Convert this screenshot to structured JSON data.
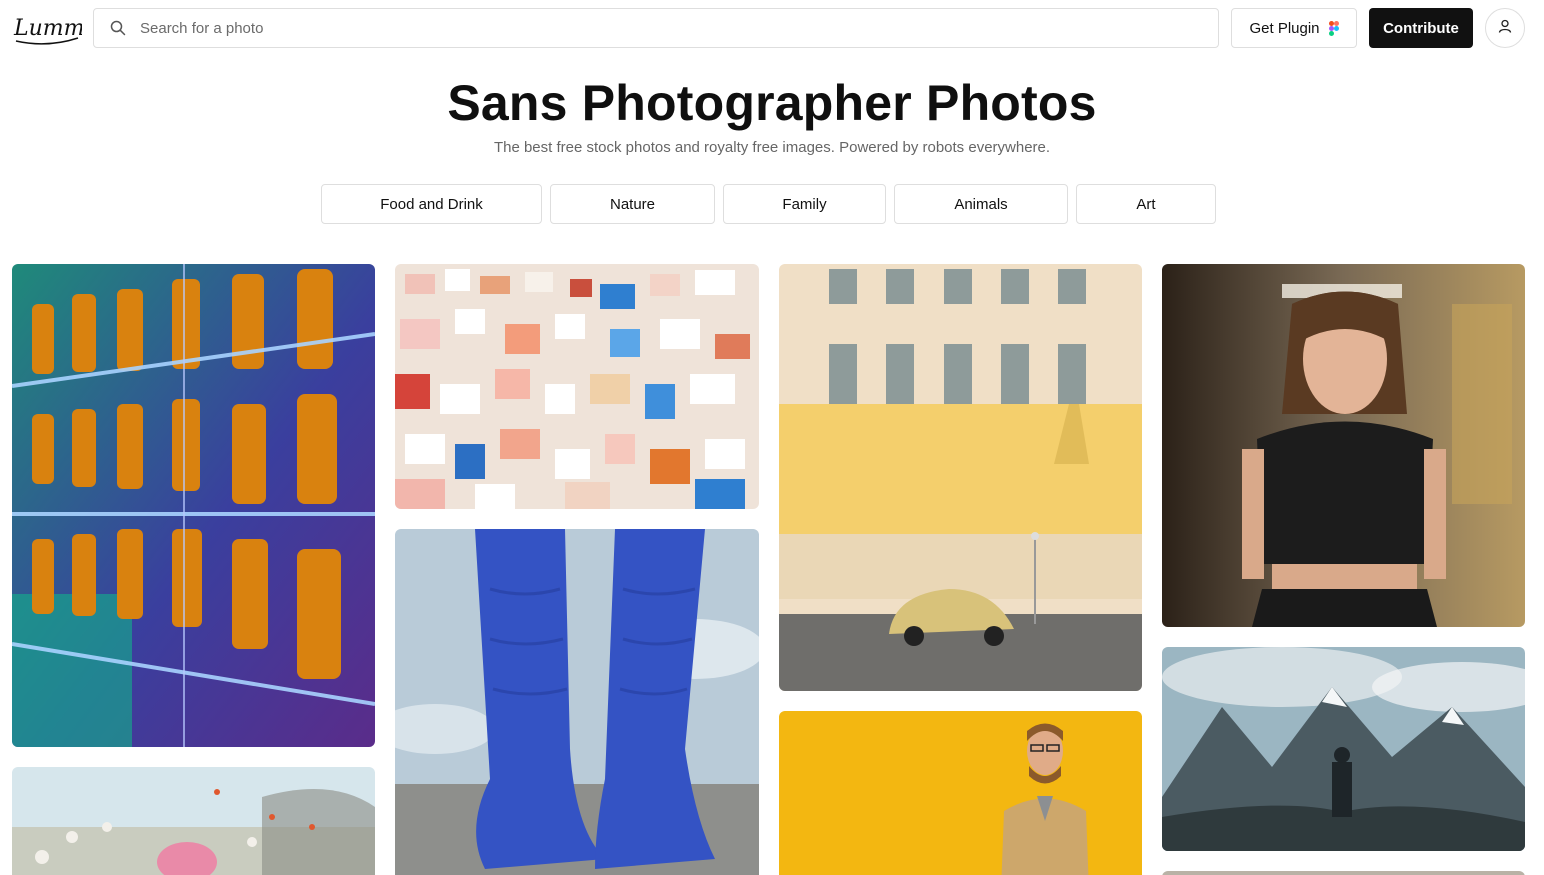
{
  "header": {
    "logo_text": "Lummi",
    "search_placeholder": "Search for a photo",
    "plugin_label": "Get Plugin",
    "contribute_label": "Contribute"
  },
  "hero": {
    "title": "Sans Photographer Photos",
    "subtitle": "The best free stock photos and royalty free images. Powered by robots everywhere."
  },
  "categories": [
    "Food and Drink",
    "Nature",
    "Family",
    "Animals",
    "Art"
  ],
  "colors": {
    "primary": "#111111",
    "border": "#dedede",
    "muted_text": "#666666"
  },
  "icons": {
    "search": "search-icon",
    "figma": "figma-icon",
    "user": "user-icon"
  }
}
